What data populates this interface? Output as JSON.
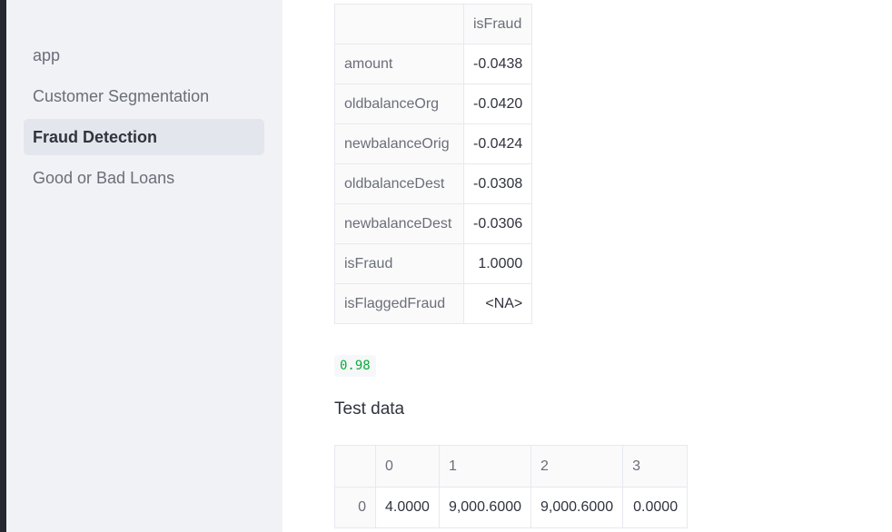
{
  "sidebar": {
    "items": [
      {
        "label": "app",
        "active": false
      },
      {
        "label": "Customer Segmentation",
        "active": false
      },
      {
        "label": "Fraud Detection",
        "active": true
      },
      {
        "label": "Good or Bad Loans",
        "active": false
      }
    ]
  },
  "correlation_table": {
    "column_header": "isFraud",
    "rows": [
      {
        "label": "amount",
        "value": "-0.0438"
      },
      {
        "label": "oldbalanceOrg",
        "value": "-0.0420"
      },
      {
        "label": "newbalanceOrig",
        "value": "-0.0424"
      },
      {
        "label": "oldbalanceDest",
        "value": "-0.0308"
      },
      {
        "label": "newbalanceDest",
        "value": "-0.0306"
      },
      {
        "label": "isFraud",
        "value": "1.0000"
      },
      {
        "label": "isFlaggedFraud",
        "value": "<NA>"
      }
    ]
  },
  "accuracy_value": "0.98",
  "test_section": {
    "title": "Test data",
    "headers": [
      "0",
      "1",
      "2",
      "3"
    ],
    "rows": [
      {
        "index": "0",
        "cells": [
          "4.0000",
          "9,000.6000",
          "9,000.6000",
          "0.0000"
        ]
      }
    ]
  }
}
